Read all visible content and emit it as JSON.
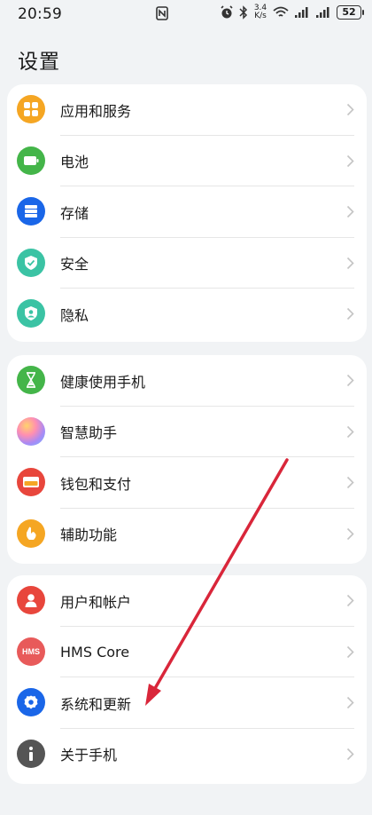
{
  "status_bar": {
    "time": "20:59",
    "speed_value": "3.4",
    "speed_unit": "K/s",
    "battery": "52"
  },
  "page": {
    "title": "设置"
  },
  "groups": [
    {
      "items": [
        {
          "label": "应用和服务",
          "icon": "apps-icon",
          "color": "#f5a623"
        },
        {
          "label": "电池",
          "icon": "battery-icon",
          "color": "#44b549"
        },
        {
          "label": "存储",
          "icon": "storage-icon",
          "color": "#1a66e8"
        },
        {
          "label": "安全",
          "icon": "shield-check-icon",
          "color": "#3bc3a4"
        },
        {
          "label": "隐私",
          "icon": "privacy-icon",
          "color": "#3bc3a4"
        }
      ]
    },
    {
      "items": [
        {
          "label": "健康使用手机",
          "icon": "hourglass-icon",
          "color": "#44b549"
        },
        {
          "label": "智慧助手",
          "icon": "assistant-icon",
          "color": "#b48cf0"
        },
        {
          "label": "钱包和支付",
          "icon": "wallet-icon",
          "color": "#e8463c"
        },
        {
          "label": "辅助功能",
          "icon": "hand-icon",
          "color": "#f5a623"
        }
      ]
    },
    {
      "items": [
        {
          "label": "用户和帐户",
          "icon": "user-icon",
          "color": "#e8463c"
        },
        {
          "label": "HMS Core",
          "icon": "hms-icon",
          "icon_text": "HMS",
          "color": "#e85a5a"
        },
        {
          "label": "系统和更新",
          "icon": "gear-icon",
          "color": "#1a66e8"
        },
        {
          "label": "关于手机",
          "icon": "info-icon",
          "color": "#555555"
        }
      ]
    }
  ],
  "annotation": {
    "color": "#d9263a"
  }
}
